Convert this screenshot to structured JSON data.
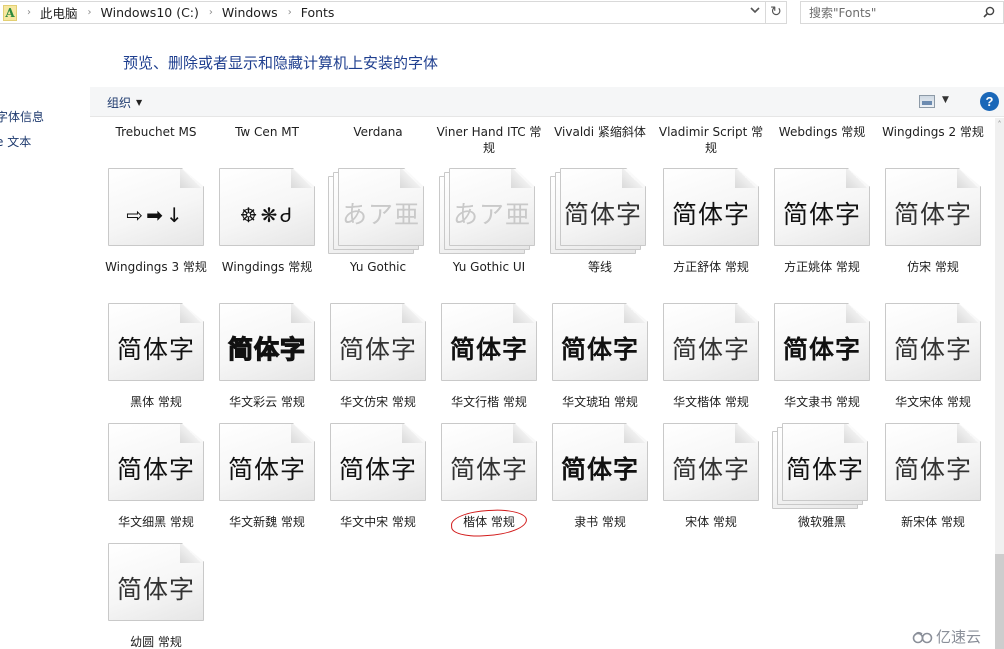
{
  "address_bar": {
    "app_icon_glyph": "A",
    "breadcrumbs": [
      "此电脑",
      "Windows10 (C:)",
      "Windows",
      "Fonts"
    ],
    "separator_glyph": "›",
    "dropdown_glyph": "⌄",
    "refresh_glyph": "↻"
  },
  "search": {
    "placeholder": "搜索\"Fonts\"",
    "value": ""
  },
  "left_nav": {
    "items": [
      "字体信息",
      "e 文本"
    ]
  },
  "header": {
    "title": "预览、删除或者显示和隐藏计算机上安装的字体"
  },
  "toolbar": {
    "organize_label": "组织",
    "caret_glyph": "▼",
    "help_glyph": "?"
  },
  "top_row_labels": [
    "Trebuchet MS",
    "Tw Cen MT",
    "Verdana",
    "Viner Hand ITC 常规",
    "Vivaldi 紧缩斜体",
    "Vladimir Script 常规",
    "Webdings 常规",
    "Wingdings 2 常规"
  ],
  "fonts": [
    {
      "name": "Wingdings 3 常规",
      "sample": "⇨➡↓",
      "style": "symbols",
      "stacked": false
    },
    {
      "name": "Wingdings 常规",
      "sample": "☸❋Ꮷ",
      "style": "symbols",
      "stacked": false
    },
    {
      "name": "Yu Gothic",
      "sample": "あア亜",
      "style": "faded",
      "stacked": true
    },
    {
      "name": "Yu Gothic UI",
      "sample": "あア亜",
      "style": "faded",
      "stacked": true
    },
    {
      "name": "等线",
      "sample": "简体字",
      "style": "light",
      "stacked": true
    },
    {
      "name": "方正舒体 常规",
      "sample": "简体字",
      "style": "serif",
      "stacked": false
    },
    {
      "name": "方正姚体 常规",
      "sample": "简体字",
      "style": "normal",
      "stacked": false
    },
    {
      "name": "仿宋 常规",
      "sample": "简体字",
      "style": "light",
      "stacked": false
    },
    {
      "name": "黑体 常规",
      "sample": "简体字",
      "style": "normal",
      "stacked": false
    },
    {
      "name": "华文彩云 常规",
      "sample": "简体字",
      "style": "outline",
      "stacked": false
    },
    {
      "name": "华文仿宋 常规",
      "sample": "简体字",
      "style": "light",
      "stacked": false
    },
    {
      "name": "华文行楷 常规",
      "sample": "简体字",
      "style": "bold",
      "stacked": false
    },
    {
      "name": "华文琥珀 常规",
      "sample": "简体字",
      "style": "bold",
      "stacked": false
    },
    {
      "name": "华文楷体 常规",
      "sample": "简体字",
      "style": "light",
      "stacked": false
    },
    {
      "name": "华文隶书 常规",
      "sample": "简体字",
      "style": "bold",
      "stacked": false
    },
    {
      "name": "华文宋体 常规",
      "sample": "简体字",
      "style": "light",
      "stacked": false
    },
    {
      "name": "华文细黑 常规",
      "sample": "简体字",
      "style": "normal",
      "stacked": false
    },
    {
      "name": "华文新魏 常规",
      "sample": "简体字",
      "style": "serif",
      "stacked": false
    },
    {
      "name": "华文中宋 常规",
      "sample": "简体字",
      "style": "serif",
      "stacked": false
    },
    {
      "name": "楷体 常规",
      "sample": "简体字",
      "style": "light",
      "stacked": false,
      "highlighted": true
    },
    {
      "name": "隶书 常规",
      "sample": "简体字",
      "style": "bold",
      "stacked": false
    },
    {
      "name": "宋体 常规",
      "sample": "简体字",
      "style": "light",
      "stacked": false
    },
    {
      "name": "微软雅黑",
      "sample": "简体字",
      "style": "normal",
      "stacked": true
    },
    {
      "name": "新宋体 常规",
      "sample": "简体字",
      "style": "light",
      "stacked": false
    },
    {
      "name": "幼圆 常规",
      "sample": "简体字",
      "style": "light",
      "stacked": false
    }
  ],
  "annotation": {
    "highlighted_font": "楷体 常规",
    "color": "#d21a1a"
  },
  "scrollbar": {
    "position_fraction": 1.0,
    "up_glyph": "˄"
  },
  "watermark": {
    "text": "亿速云"
  },
  "colors": {
    "title": "#1f3f8f",
    "help_button": "#1a67b8",
    "toolbar_bg": "#f5f6f7"
  }
}
